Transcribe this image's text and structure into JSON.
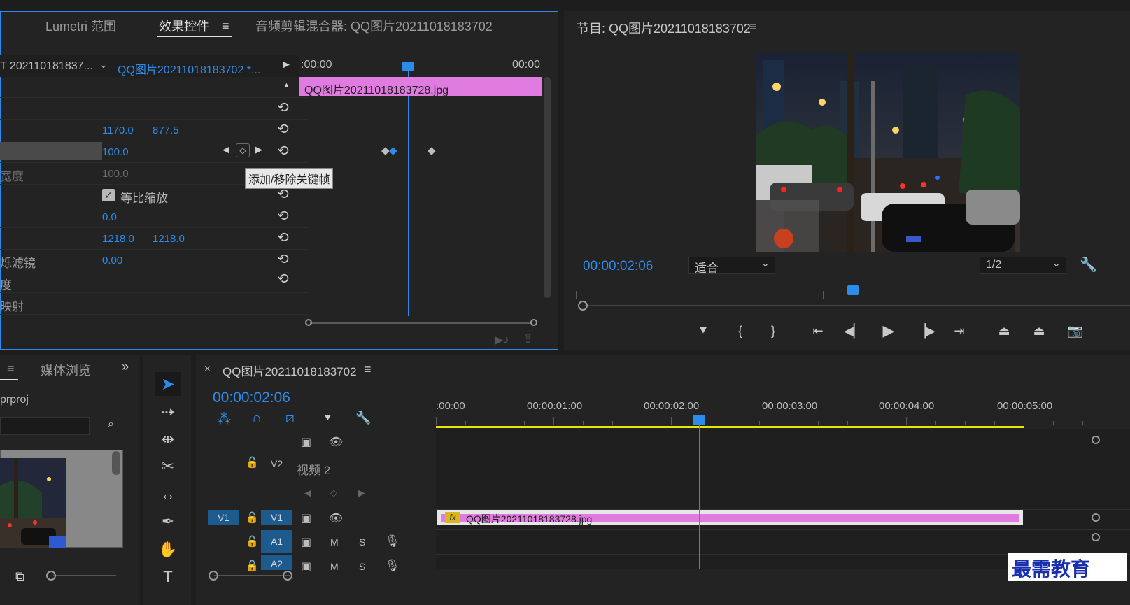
{
  "effect_panel": {
    "tabs": [
      {
        "label": "Lumetri 范围"
      },
      {
        "label": "效果控件"
      },
      {
        "label": "音频剪辑混合器: QQ图片20211018183702"
      }
    ],
    "active_tab": "效果控件",
    "source_label": "T 202110181837...",
    "sequence_label": "QQ图片20211018183702 *...",
    "time_start": ":00:00",
    "time_end": "00:00",
    "clip_name": "QQ图片20211018183728.jpg",
    "params": [
      {
        "label": "",
        "v1": "",
        "v2": ""
      },
      {
        "label": "",
        "v1": "",
        "v2": ""
      },
      {
        "label": "",
        "v1": "1170.0",
        "v2": "877.5"
      },
      {
        "label": "",
        "v1": "100.0",
        "v2": ""
      },
      {
        "label": "宽度",
        "v1": "100.0",
        "v2": ""
      },
      {
        "label": "",
        "v1": "",
        "v2": ""
      },
      {
        "label": "",
        "v1": "0.0",
        "v2": ""
      },
      {
        "label": "",
        "v1": "1218.0",
        "v2": "1218.0"
      },
      {
        "label": "烁滤镜",
        "v1": "0.00",
        "v2": ""
      },
      {
        "label": "度",
        "v1": "",
        "v2": ""
      },
      {
        "label": "映射",
        "v1": "",
        "v2": ""
      }
    ],
    "uniform_scale_label": "等比缩放",
    "uniform_scale_checked": true,
    "tooltip": "添加/移除关键帧"
  },
  "program_monitor": {
    "title": "节目: QQ图片20211018183702",
    "timecode": "00:00:02:06",
    "fit_label": "适合",
    "resolution_label": "1/2"
  },
  "project_panel": {
    "tab": "媒体浏览",
    "file_name": "prproj"
  },
  "timeline": {
    "title": "QQ图片20211018183702",
    "timecode": "00:00:02:06",
    "ruler_labels": [
      ":00:00",
      "00:00:01:00",
      "00:00:02:00",
      "00:00:03:00",
      "00:00:04:00",
      "00:00:05:00"
    ],
    "tracks": [
      {
        "id": "V2",
        "name": "视频 2"
      },
      {
        "id": "V1",
        "src": "V1"
      },
      {
        "id": "A1",
        "m": "M",
        "s": "S"
      },
      {
        "id": "A2",
        "m": "M",
        "s": "S"
      }
    ],
    "clip_name": "QQ图片20211018183728.jpg",
    "fx_label": "fx"
  },
  "watermark": "最需教育",
  "colors": {
    "accent": "#2d8ceb",
    "clip_pink": "#e07be0",
    "work_area": "#e6e600"
  }
}
